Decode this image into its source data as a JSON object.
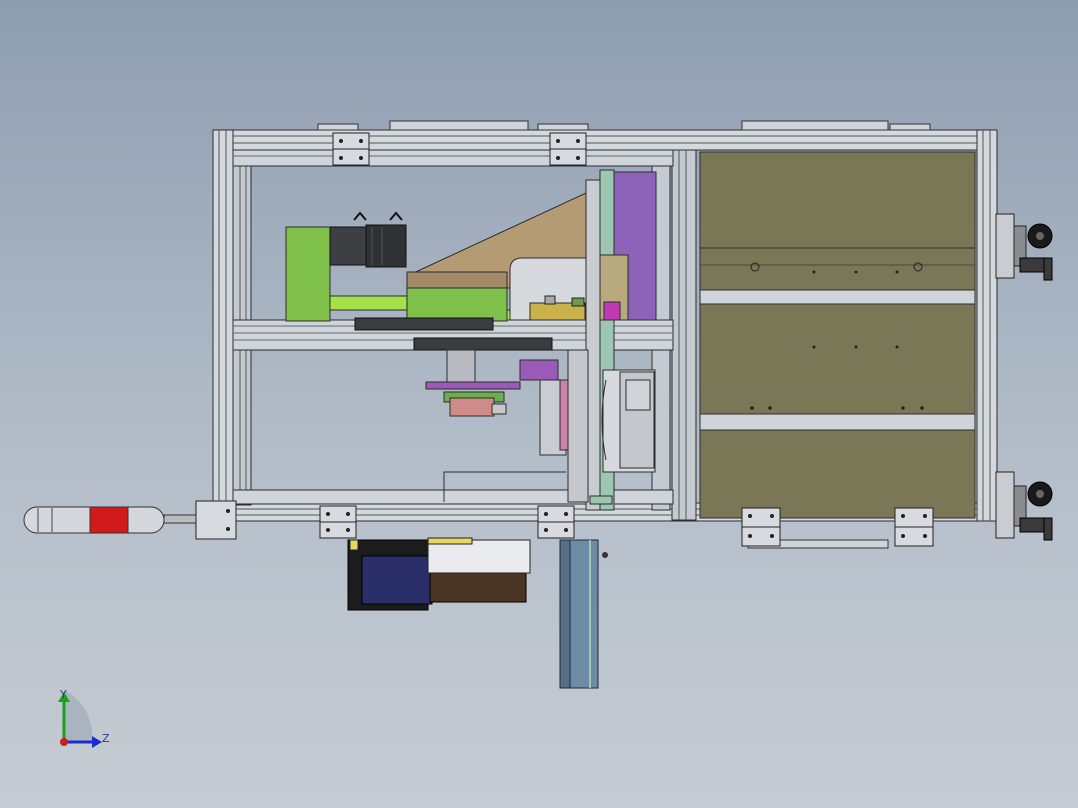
{
  "viewport": {
    "background_top": "#8e9db0",
    "background_bottom": "#c6ccd3"
  },
  "model": {
    "frame_color": "#c9cfd6",
    "panel_color": "#7a7757",
    "motor_color": "#3d3f42",
    "bracket_color": "#7ec04a",
    "wedge_color": "#b59b74",
    "purple_part_color": "#8c63b8",
    "magenta_part_color": "#c03ab8",
    "blue_plate_color": "#6e8ba6",
    "indicator_red": "#d21a1a"
  },
  "triad": {
    "y_label": "Y",
    "z_label": "Z",
    "icons": [
      "y-axis-arrow-icon",
      "z-axis-arrow-icon",
      "x-axis-dot-icon"
    ]
  }
}
